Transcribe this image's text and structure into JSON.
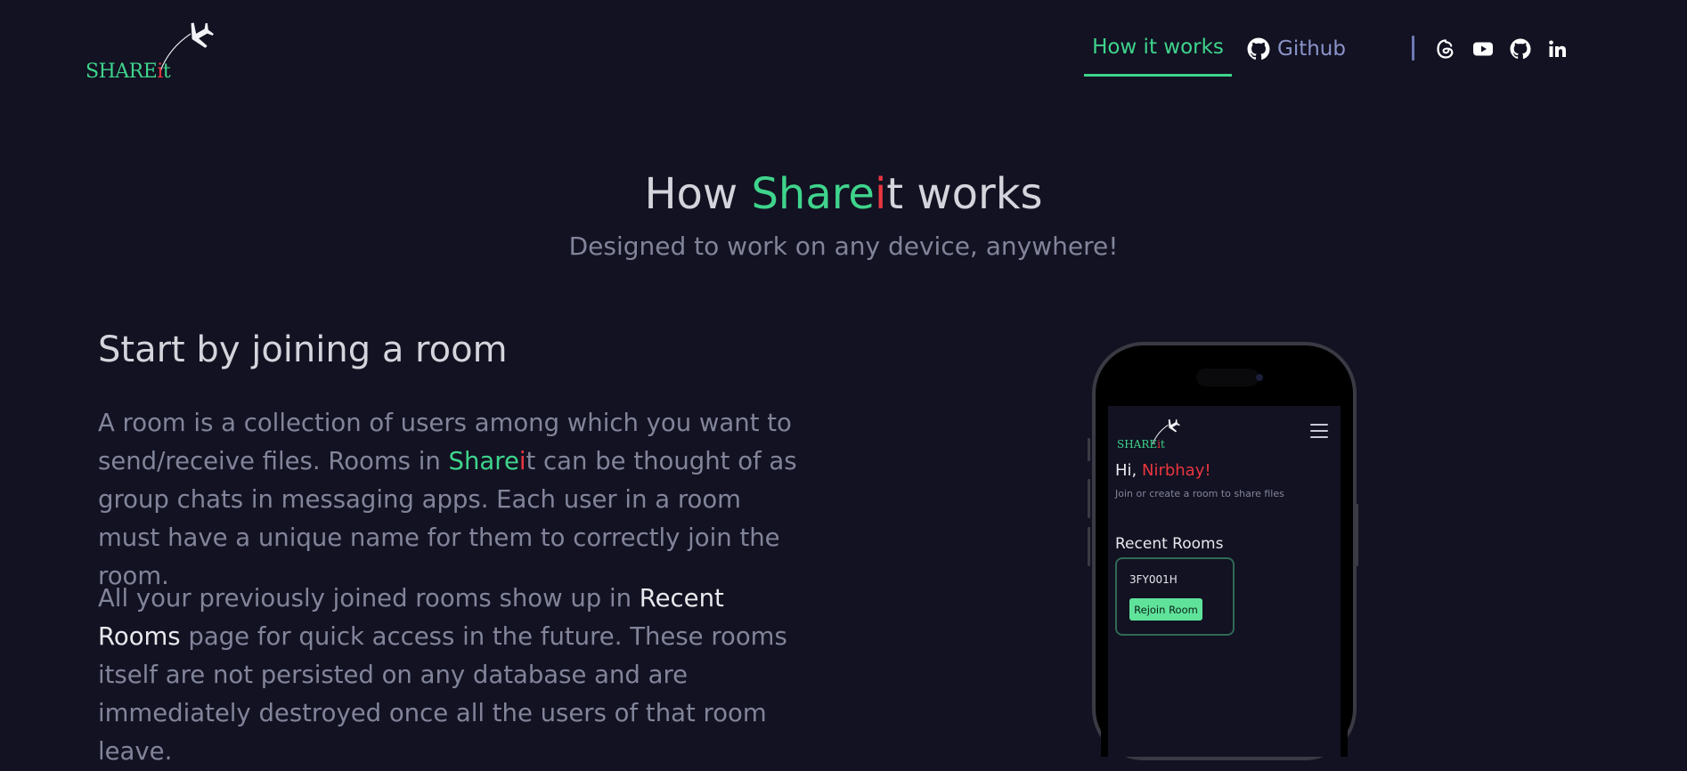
{
  "header": {
    "logo": {
      "text_main": "SHARE",
      "text_i": "i",
      "text_end": "t"
    },
    "nav": {
      "how_it_works": "How it works",
      "github": "Github"
    },
    "socials": [
      "threads-icon",
      "youtube-icon",
      "github-icon",
      "linkedin-icon"
    ]
  },
  "hero": {
    "title_pre": "How ",
    "title_brand_green": "Share",
    "title_brand_red": "i",
    "title_brand_end": "t",
    "title_post": " works",
    "subtitle": "Designed to work on any device, anywhere!"
  },
  "section": {
    "title": "Start by joining a room",
    "para1": {
      "a": "A room is a collection of users among which you want to send/receive files. Rooms in ",
      "brand_green": "Share",
      "brand_red": "i",
      "brand_end": "t",
      "b": " can be thought of as group chats in messaging apps. Each user in a room must have a unique name for them to correctly join the room."
    },
    "para2": {
      "a": "All your previously joined rooms show up in ",
      "highlight": "Recent Rooms",
      "b": " page for quick access in the future. These rooms itself are not persisted on any database and are immediately destroyed once all the users of that room leave."
    }
  },
  "phone": {
    "logo": {
      "text_main": "SHARE",
      "text_i": "i",
      "text_end": "t"
    },
    "greeting_pre": "Hi, ",
    "greeting_name": "Nirbhay!",
    "join_text": "Join or create a room to share files",
    "recent_title": "Recent Rooms",
    "room_code": "3FY001H",
    "rejoin_label": "Rejoin Room"
  },
  "colors": {
    "background": "#121222",
    "brand_green": "#3fd48c",
    "brand_red": "#e8363f",
    "muted_text": "#82849a",
    "nav_link": "#8b93c9"
  }
}
